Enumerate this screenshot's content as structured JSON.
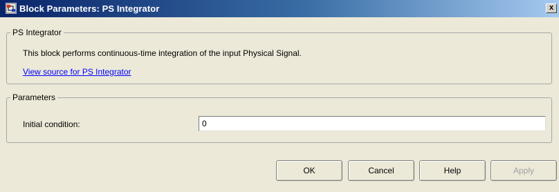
{
  "window": {
    "title": "Block Parameters: PS Integrator",
    "close_label": "x"
  },
  "block_group": {
    "legend": "PS Integrator",
    "description": "This block performs continuous-time integration of the input Physical Signal.",
    "link_text": "View source for PS Integrator"
  },
  "parameters_group": {
    "legend": "Parameters",
    "initial_condition_label": "Initial condition:",
    "initial_condition_value": "0"
  },
  "buttons": {
    "ok": "OK",
    "cancel": "Cancel",
    "help": "Help",
    "apply": "Apply"
  },
  "icons": {
    "title_icon": "simulink-block-icon"
  }
}
